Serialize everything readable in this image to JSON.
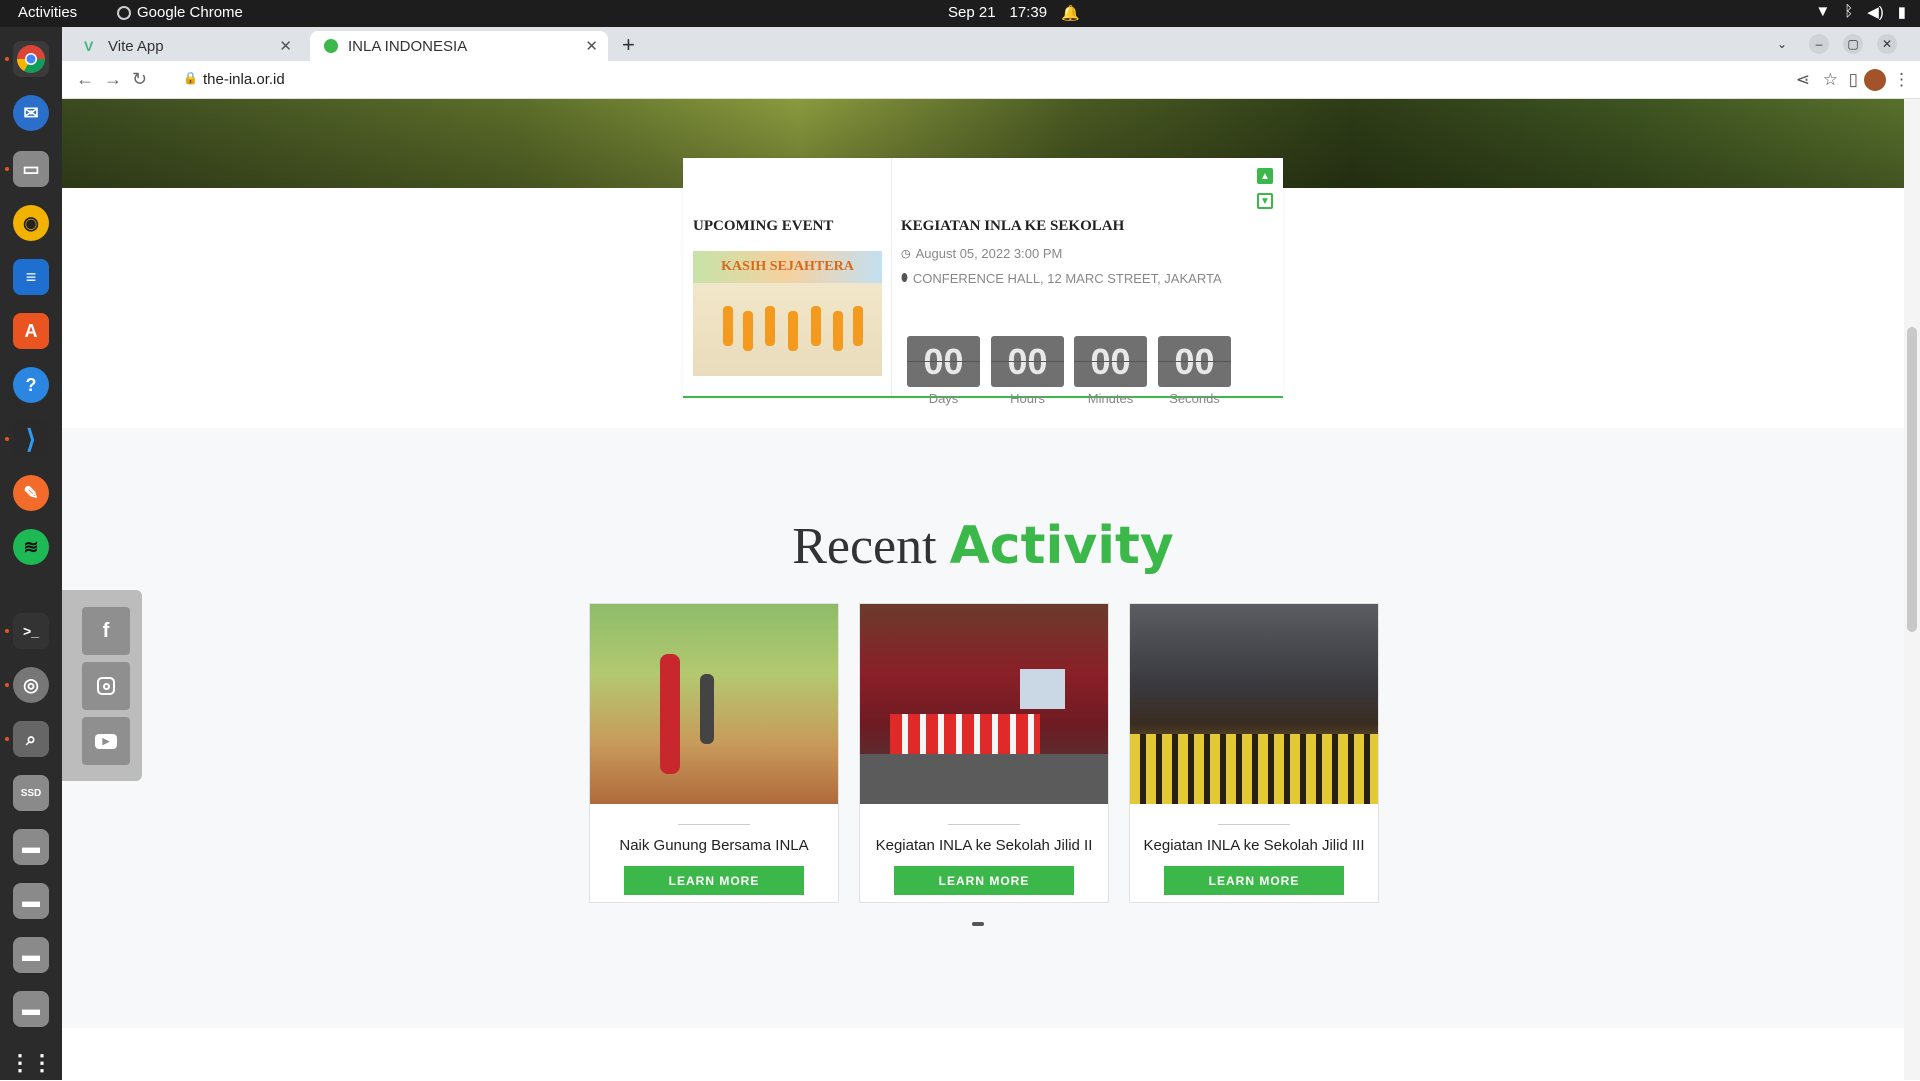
{
  "system_bar": {
    "activities": "Activities",
    "app_name": "Google Chrome",
    "date": "Sep 21",
    "time": "17:39"
  },
  "browser": {
    "tabs": [
      {
        "label": "Vite App",
        "active": false
      },
      {
        "label": "INLA INDONESIA",
        "active": true
      }
    ],
    "url": "the-inla.or.id"
  },
  "event": {
    "section_heading": "UPCOMING EVENT",
    "image_banner": "KASIH SEJAHTERA",
    "title": "KEGIATAN INLA KE SEKOLAH",
    "datetime": "August 05, 2022 3:00 PM",
    "location": "CONFERENCE HALL, 12 MARC STREET, JAKARTA",
    "countdown": [
      {
        "value": "00",
        "label": "Days"
      },
      {
        "value": "00",
        "label": "Hours"
      },
      {
        "value": "00",
        "label": "Minutes"
      },
      {
        "value": "00",
        "label": "Seconds"
      }
    ]
  },
  "recent": {
    "heading_plain": "Recent",
    "heading_accent": "Activity",
    "accent_color": "#3cb84a",
    "cards": [
      {
        "title": "Naik Gunung Bersama INLA",
        "button": "LEARN MORE"
      },
      {
        "title": "Kegiatan INLA ke Sekolah Jilid II",
        "button": "LEARN MORE"
      },
      {
        "title": "Kegiatan INLA ke Sekolah Jilid III",
        "button": "LEARN MORE"
      }
    ]
  },
  "social": [
    "facebook-icon",
    "instagram-icon",
    "youtube-icon"
  ]
}
